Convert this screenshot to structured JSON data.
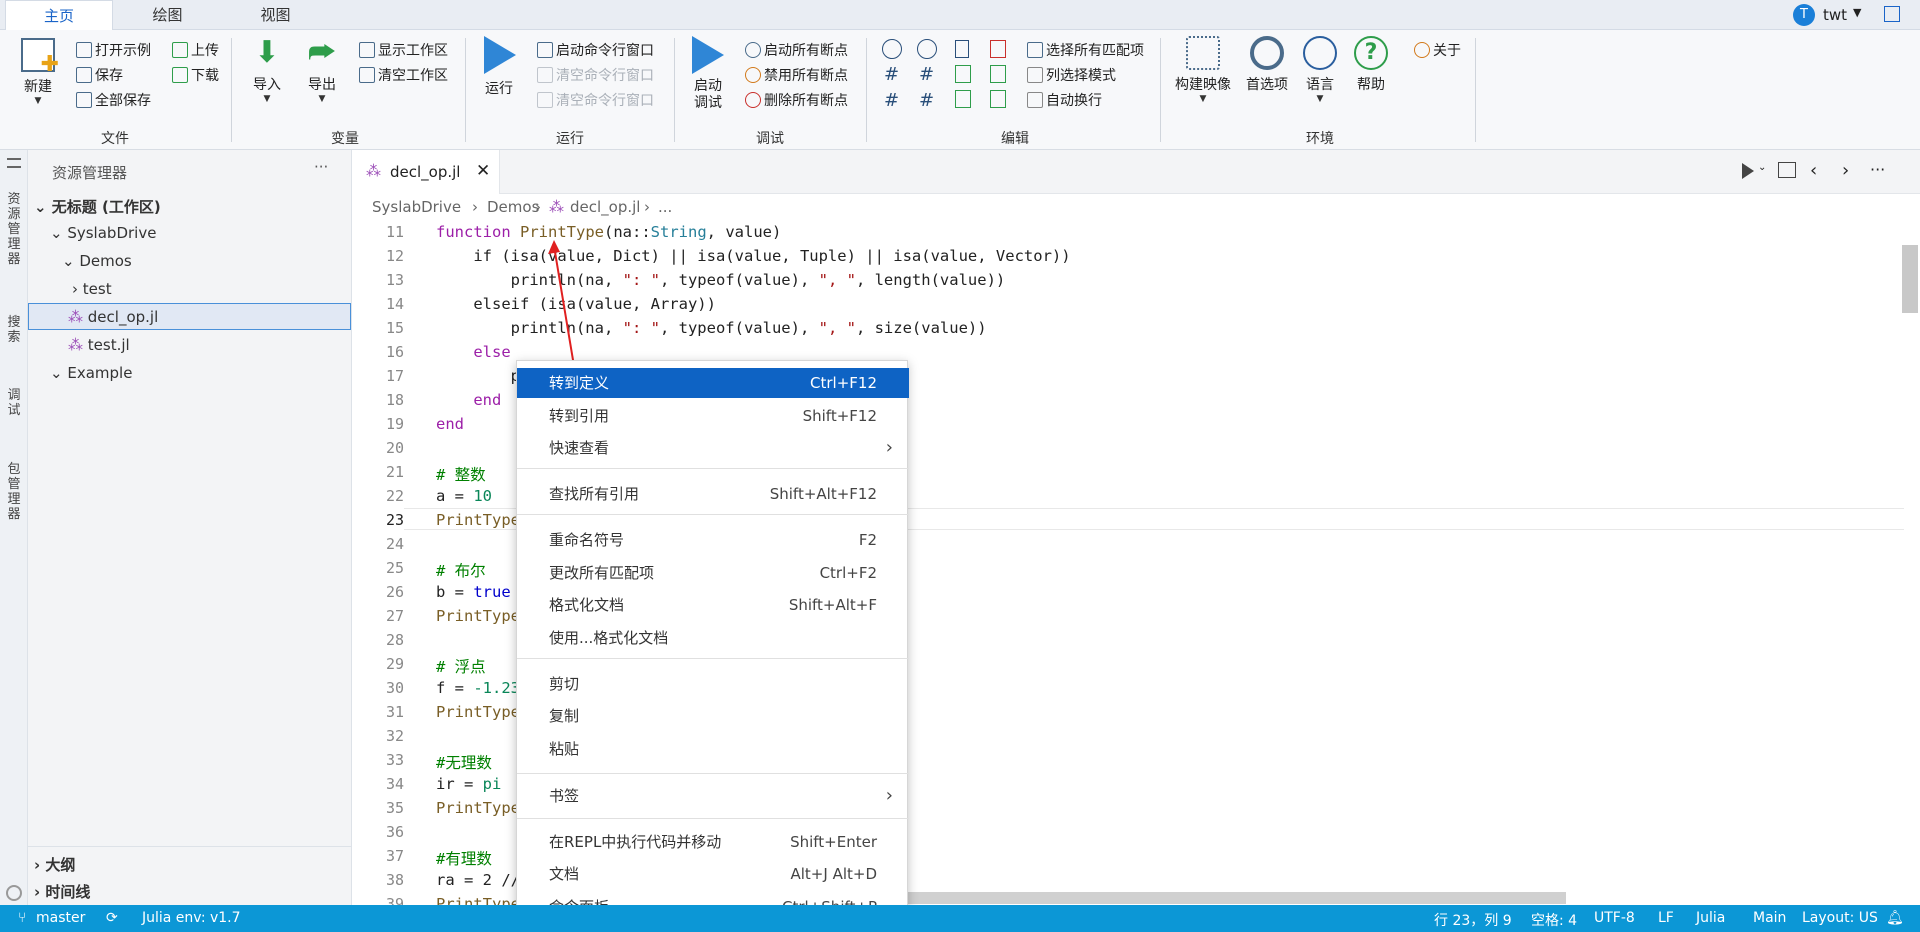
{
  "ribbon_tabs": [
    "主页",
    "绘图",
    "视图"
  ],
  "user": {
    "initial": "T",
    "name": "twt"
  },
  "groups": {
    "file": "文件",
    "vars": "变量",
    "run": "运行",
    "debug": "调试",
    "edit": "编辑",
    "env": "环境"
  },
  "file": {
    "new": "新建",
    "open_example": "打开示例",
    "save": "保存",
    "save_all": "全部保存",
    "upload": "上传",
    "download": "下载"
  },
  "vars": {
    "import": "导入",
    "export": "导出",
    "show_ws": "显示工作区",
    "clear_ws": "清空工作区"
  },
  "run": {
    "run": "运行",
    "start_cmd": "启动命令行窗口",
    "clear_cmd1": "清空命令行窗口",
    "clear_cmd2": "清空命令行窗口"
  },
  "debug": {
    "start": "启动",
    "start2": "调试",
    "start_all_bp": "启动所有断点",
    "disable_all_bp": "禁用所有断点",
    "delete_all_bp": "删除所有断点"
  },
  "edit": {
    "select_all_match": "选择所有匹配项",
    "column_select": "列选择模式",
    "auto_wrap": "自动换行"
  },
  "env": {
    "build_image": "构建映像",
    "prefs": "首选项",
    "lang": "语言",
    "help": "帮助",
    "about": "关于"
  },
  "activity": [
    "资源管理器",
    "搜索",
    "调试",
    "包管理器"
  ],
  "explorer": {
    "title": "资源管理器",
    "more": "···",
    "workspace": "无标题 (工作区)",
    "items": [
      "SyslabDrive",
      "Demos",
      "test",
      "decl_op.jl",
      "test.jl",
      "Example"
    ],
    "outline": "大纲",
    "timeline": "时间线"
  },
  "editor": {
    "tab": "decl_op.jl",
    "crumbs": [
      "SyslabDrive",
      "Demos",
      "decl_op.jl",
      "..."
    ]
  },
  "code_lines": [
    "11",
    "12",
    "13",
    "14",
    "15",
    "16",
    "17",
    "18",
    "19",
    "20",
    "21",
    "22",
    "23",
    "24",
    "25",
    "26",
    "27",
    "28",
    "29",
    "30",
    "31",
    "32",
    "33",
    "34",
    "35",
    "36",
    "37",
    "38",
    "39"
  ],
  "code": {
    "l11a": "function ",
    "l11b": "PrintType",
    "l11c": "(na::",
    "l11d": "String",
    "l11e": ", value)",
    "l12": "    if (isa(value, Dict) || isa(value, Tuple) || isa(value, Vector))",
    "l13a": "        println(na, ",
    "l13b": "\": \"",
    "l13c": ", typeof(value), ",
    "l13d": "\", \"",
    "l13e": ", length(value))",
    "l14": "    elseif (isa(value, Array))",
    "l15a": "        println(na, ",
    "l15b": "\": \"",
    "l15c": ", typeof(value), ",
    "l15d": "\", \"",
    "l15e": ", size(value))",
    "l16": "    else",
    "l17": "        p",
    "l18": "    end",
    "l19": "end",
    "l21": "# 整数",
    "l22a": "a = ",
    "l22b": "10",
    "l23": "PrintType",
    "l25": "# 布尔",
    "l26a": "b = ",
    "l26b": "true",
    "l27": "PrintType",
    "l29": "# 浮点",
    "l30a": "f = ",
    "l30b": "-1.23",
    "l31": "PrintType",
    "l33": "#无理数",
    "l34a": "ir = ",
    "l34b": "pi",
    "l35": "PrintType",
    "l37": "#有理数",
    "l38": "ra = 2 //",
    "l39": "PrintType"
  },
  "menu": [
    {
      "label": "转到定义",
      "shortcut": "Ctrl+F12"
    },
    {
      "label": "转到引用",
      "shortcut": "Shift+F12"
    },
    {
      "label": "快速查看",
      "shortcut": "›"
    },
    {
      "label": "查找所有引用",
      "shortcut": "Shift+Alt+F12"
    },
    {
      "label": "重命名符号",
      "shortcut": "F2"
    },
    {
      "label": "更改所有匹配项",
      "shortcut": "Ctrl+F2"
    },
    {
      "label": "格式化文档",
      "shortcut": "Shift+Alt+F"
    },
    {
      "label": "使用...格式化文档",
      "shortcut": ""
    },
    {
      "label": "剪切",
      "shortcut": ""
    },
    {
      "label": "复制",
      "shortcut": ""
    },
    {
      "label": "粘贴",
      "shortcut": ""
    },
    {
      "label": "书签",
      "shortcut": "›"
    },
    {
      "label": "在REPL中执行代码并移动",
      "shortcut": "Shift+Enter"
    },
    {
      "label": "文档",
      "shortcut": "Alt+J Alt+D"
    },
    {
      "label": "命令面板...",
      "shortcut": "Ctrl+Shift+P"
    }
  ],
  "status": {
    "branch": "master",
    "env": "Julia env: v1.7",
    "pos": "行 23，列 9",
    "spaces": "空格: 4",
    "enc": "UTF-8",
    "eol": "LF",
    "lang": "Julia",
    "main": "Main",
    "layout": "Layout: US"
  },
  "colors": {
    "accent": "#0e63c4",
    "status": "#0c97d6"
  }
}
